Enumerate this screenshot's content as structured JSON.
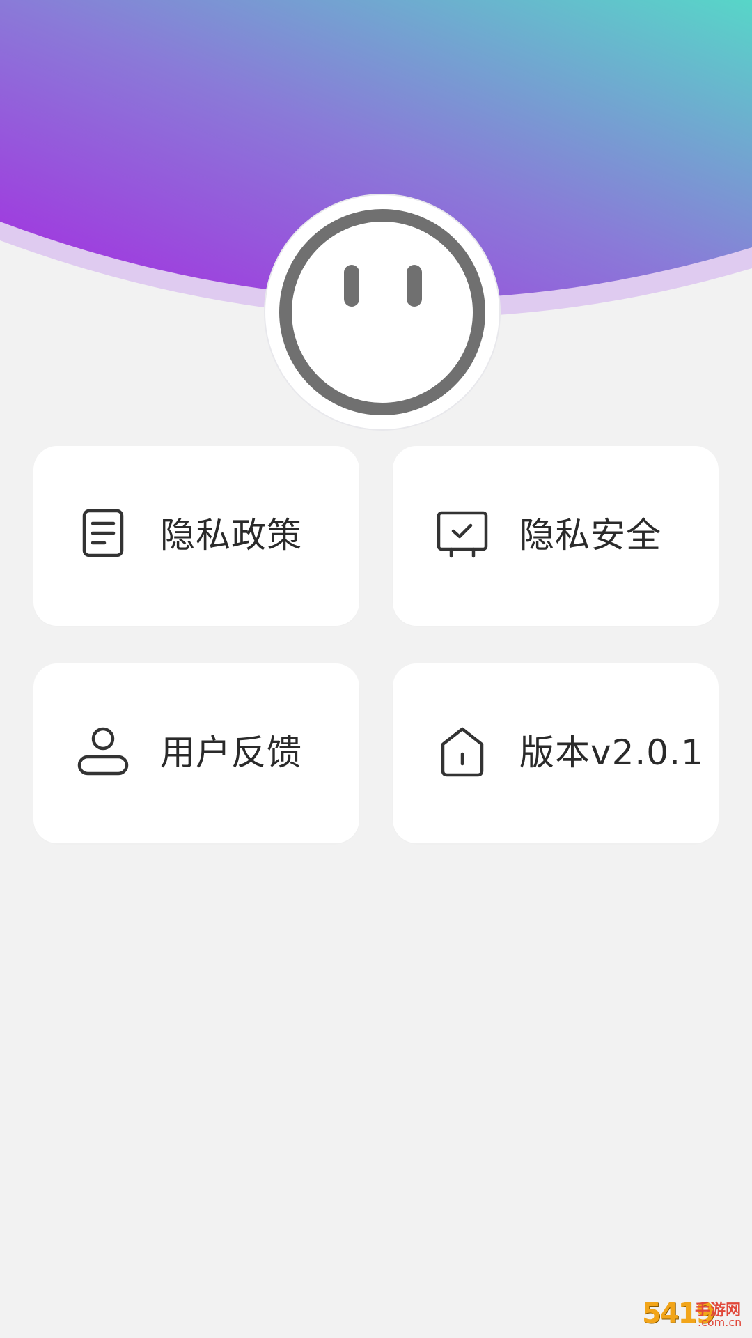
{
  "header": {
    "gradient_colors": [
      "#a52be0",
      "#8a6fd6",
      "#57d6c8"
    ]
  },
  "avatar": {
    "icon": "smiley-face-icon"
  },
  "menu": {
    "items": [
      {
        "label": "隐私政策",
        "icon": "document-icon"
      },
      {
        "label": "隐私安全",
        "icon": "monitor-check-icon"
      },
      {
        "label": "用户反馈",
        "icon": "user-icon"
      },
      {
        "label": "版本v2.0.1",
        "icon": "home-icon"
      }
    ]
  },
  "watermark": {
    "number": "5419",
    "name": "手游网",
    "domain": ".com.cn"
  }
}
